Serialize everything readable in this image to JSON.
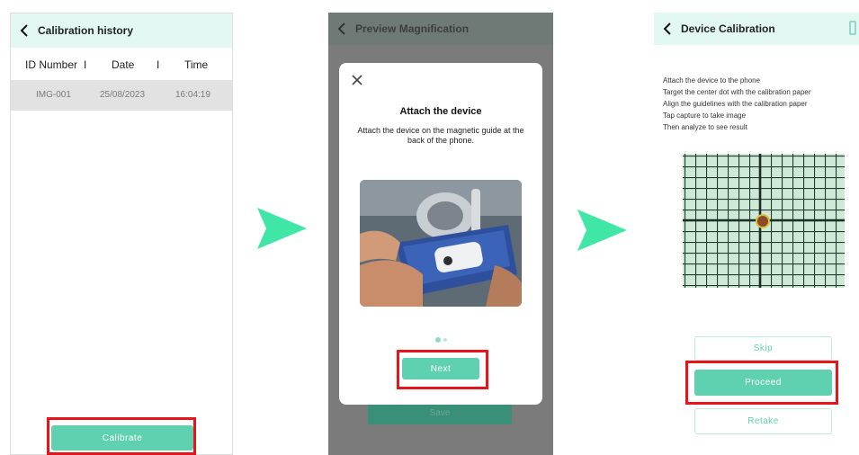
{
  "screen1": {
    "title": "Calibration history",
    "headers": {
      "id": "ID Number",
      "sep1": "I",
      "date": "Date",
      "sep2": "I",
      "time": "Time"
    },
    "rows": [
      {
        "id": "IMG-001",
        "date": "25/08/2023",
        "time": "16:04:19"
      }
    ],
    "calibrate_label": "Calibrate"
  },
  "screen2": {
    "title": "Preview Magnification",
    "modal_title": "Attach the device",
    "modal_description": "Attach the device on the magnetic guide at the back of the phone.",
    "next_label": "Next",
    "behind_button_label": "Save",
    "page_count": 2,
    "current_page": 1
  },
  "screen3": {
    "title": "Device Calibration",
    "instructions": [
      "Attach the device to the phone",
      "Target the center dot with the calibration paper",
      "Align the guidelines with the calibration paper",
      "Tap capture to take image",
      "Then analyze to see result"
    ],
    "skip_label": "Skip",
    "proceed_label": "Proceed",
    "retake_label": "Retake"
  },
  "icons": {
    "back": "chevron-left-icon",
    "close": "close-icon",
    "flow_arrow": "play-arrow-icon",
    "settings": "settings-icon"
  },
  "colors": {
    "accent": "#5fd1b1",
    "appbar_bg": "#e3f8f2",
    "highlight": "#e8141b",
    "overlay": "#7b7b7b",
    "arrow": "#3fe6a6"
  }
}
